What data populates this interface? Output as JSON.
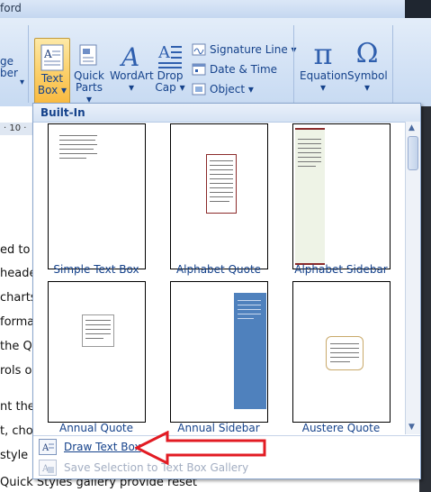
{
  "window": {
    "title_fragment": "ford"
  },
  "ribbon": {
    "left_cut_label_1": "ge",
    "left_cut_label_2": "ber",
    "left_cut_arrow": "▾",
    "text_box": {
      "line1": "Text",
      "line2": "Box ▾"
    },
    "quick_parts": {
      "line1": "Quick",
      "line2": "Parts ▾"
    },
    "wordart": {
      "line1": "WordArt",
      "line2": "▾"
    },
    "drop_cap": {
      "line1": "Drop",
      "line2": "Cap ▾"
    },
    "signature_line": "Signature Line ▾",
    "date_time": "Date & Time",
    "object": "Object ▾",
    "equation": {
      "line1": "Equation",
      "line2": "▾"
    },
    "symbol": {
      "line1": "Symbol",
      "line2": "▾"
    },
    "pi_glyph": "π",
    "omega_glyph": "Ω"
  },
  "ruler": {
    "label": "· 10 ·"
  },
  "document": {
    "lines": [
      "ed to c",
      "heade",
      "charts,",
      "forma",
      "the Q",
      "rols o",
      "nt the",
      "t, choo",
      "style g",
      "Quick Styles gallery provide reset"
    ]
  },
  "gallery": {
    "header": "Built-In",
    "items": [
      {
        "label": "Simple Text Box"
      },
      {
        "label": "Alphabet Quote"
      },
      {
        "label": "Alphabet Sidebar"
      },
      {
        "label": "Annual Quote"
      },
      {
        "label": "Annual Sidebar"
      },
      {
        "label": "Austere Quote"
      }
    ],
    "draw_text_box": "Draw Text Box",
    "save_selection": "Save Selection to Text Box Gallery"
  },
  "colors": {
    "accent": "#15428b",
    "arrow": "#e21b23",
    "sidebar_blue": "#4f81bd"
  },
  "icons": {
    "text_box": "text-box-icon",
    "quick_parts": "quick-parts-icon",
    "wordart": "wordart-icon",
    "drop_cap": "drop-cap-icon"
  }
}
